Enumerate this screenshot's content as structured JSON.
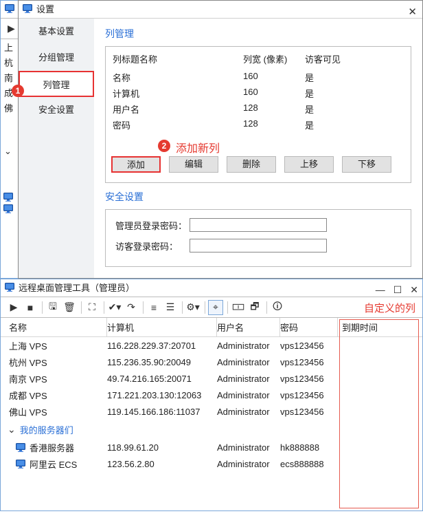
{
  "under_window": {
    "sidebar_items": [
      "上",
      "杭",
      "南",
      "成",
      "佛"
    ],
    "chevron": "⌄"
  },
  "modal": {
    "title": "设置",
    "nav": [
      {
        "label": "基本设置",
        "selected": false
      },
      {
        "label": "分组管理",
        "selected": false
      },
      {
        "label": "列管理",
        "selected": true
      },
      {
        "label": "安全设置",
        "selected": false
      }
    ],
    "badge1": "1",
    "section_title": "列管理",
    "cols_head": {
      "c1": "列标题名称",
      "c2": "列宽 (像素)",
      "c3": "访客可见"
    },
    "rows": [
      {
        "c1": "名称",
        "c2": "160",
        "c3": "是"
      },
      {
        "c1": "计算机",
        "c2": "160",
        "c3": "是"
      },
      {
        "c1": "用户名",
        "c2": "128",
        "c3": "是"
      },
      {
        "c1": "密码",
        "c2": "128",
        "c3": "是"
      }
    ],
    "badge2": "2",
    "anno2": "添加新列",
    "buttons": {
      "add": "添加",
      "edit": "编辑",
      "del": "删除",
      "up": "上移",
      "down": "下移"
    },
    "sec2_title": "安全设置",
    "pwd1_label": "管理员登录密码：",
    "pwd2_label": "访客登录密码："
  },
  "lower": {
    "title": "远程桌面管理工具（管理员）",
    "red_label": "自定义的列",
    "cols": {
      "name": "名称",
      "comp": "计算机",
      "user": "用户名",
      "pass": "密码",
      "exp": "到期时间"
    },
    "rows": [
      {
        "name": "上海 VPS",
        "comp": "116.228.229.37:20701",
        "user": "Administrator",
        "pass": "vps123456"
      },
      {
        "name": "杭州 VPS",
        "comp": "115.236.35.90:20049",
        "user": "Administrator",
        "pass": "vps123456"
      },
      {
        "name": "南京 VPS",
        "comp": "49.74.216.165:20071",
        "user": "Administrator",
        "pass": "vps123456"
      },
      {
        "name": "成都 VPS",
        "comp": "171.221.203.130:12063",
        "user": "Administrator",
        "pass": "vps123456"
      },
      {
        "name": "佛山 VPS",
        "comp": "119.145.166.186:11037",
        "user": "Administrator",
        "pass": "vps123456"
      }
    ],
    "group": "我的服务器们",
    "servers": [
      {
        "name": "香港服务器",
        "comp": "118.99.61.20",
        "user": "Administrator",
        "pass": "hk888888"
      },
      {
        "name": "阿里云 ECS",
        "comp": "123.56.2.80",
        "user": "Administrator",
        "pass": "ecs888888"
      }
    ]
  }
}
